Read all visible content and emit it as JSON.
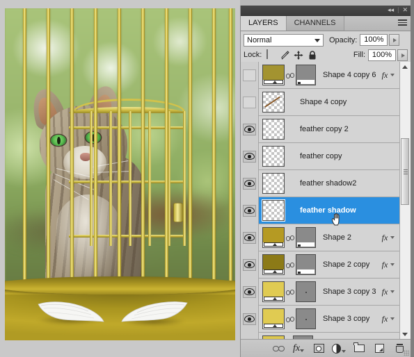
{
  "panel": {
    "titlebar": {
      "collapse_icon": "collapse-double-arrow-icon",
      "collapse_glyph": "◂◂",
      "close_glyph": "✕",
      "separator": "|"
    },
    "tabs": [
      {
        "label": "LAYERS",
        "active": true
      },
      {
        "label": "CHANNELS",
        "active": false
      }
    ],
    "menu_icon": "panel-menu-icon",
    "blend_mode": {
      "value": "Normal",
      "caret_icon": "chevron-down-icon"
    },
    "opacity": {
      "label": "Opacity:",
      "value": "100%",
      "stepper_icon": "play-triangle-icon"
    },
    "fill": {
      "label": "Fill:",
      "value": "100%",
      "stepper_icon": "play-triangle-icon"
    },
    "lock": {
      "label": "Lock:",
      "items": [
        {
          "name": "lock-transparent-pixels-icon",
          "glyph": "checker"
        },
        {
          "name": "lock-image-pixels-brush-icon",
          "glyph": "brush"
        },
        {
          "name": "lock-position-move-icon",
          "glyph": "move"
        },
        {
          "name": "lock-all-padlock-icon",
          "glyph": "lock"
        }
      ]
    }
  },
  "layers": [
    {
      "name": "Shape 4 copy 6",
      "visible": false,
      "selected": false,
      "thumb_type": "gold-gradient",
      "thumb_color": "#a39330",
      "has_link": true,
      "has_mask": true,
      "mask_type": "gray-bottom-white",
      "has_fx": true
    },
    {
      "name": "Shape 4 copy",
      "visible": false,
      "selected": false,
      "thumb_type": "transparent-diagonal",
      "thumb_color": "",
      "has_link": false,
      "has_mask": false,
      "mask_type": "",
      "has_fx": false
    },
    {
      "name": "feather copy 2",
      "visible": true,
      "selected": false,
      "thumb_type": "transparent",
      "thumb_color": "",
      "has_link": false,
      "has_mask": false,
      "mask_type": "",
      "has_fx": false
    },
    {
      "name": "feather copy",
      "visible": true,
      "selected": false,
      "thumb_type": "transparent",
      "thumb_color": "",
      "has_link": false,
      "has_mask": false,
      "mask_type": "",
      "has_fx": false
    },
    {
      "name": "feather shadow2",
      "visible": true,
      "selected": false,
      "thumb_type": "transparent",
      "thumb_color": "",
      "has_link": false,
      "has_mask": false,
      "mask_type": "",
      "has_fx": false
    },
    {
      "name": "feather shadow",
      "visible": true,
      "selected": true,
      "thumb_type": "transparent",
      "thumb_color": "",
      "has_link": false,
      "has_mask": false,
      "mask_type": "",
      "has_fx": false
    },
    {
      "name": "Shape 2",
      "visible": true,
      "selected": false,
      "thumb_type": "gold-gradient",
      "thumb_color": "#b59a23",
      "has_link": true,
      "has_mask": true,
      "mask_type": "gray-bottom-white",
      "has_fx": true
    },
    {
      "name": "Shape 2 copy",
      "visible": true,
      "selected": false,
      "thumb_type": "gold-gradient",
      "thumb_color": "#8c7a17",
      "has_link": true,
      "has_mask": true,
      "mask_type": "gray-bottom-white",
      "has_fx": true
    },
    {
      "name": "Shape 3 copy 3",
      "visible": true,
      "selected": false,
      "thumb_type": "gold-gradient",
      "thumb_color": "#e0cb52",
      "has_link": true,
      "has_mask": true,
      "mask_type": "gray-dot",
      "has_fx": true
    },
    {
      "name": "Shape 3 copy",
      "visible": true,
      "selected": false,
      "thumb_type": "gold-gradient",
      "thumb_color": "#e0cb52",
      "has_link": true,
      "has_mask": true,
      "mask_type": "gray-dot",
      "has_fx": true
    },
    {
      "name": "",
      "visible": true,
      "selected": false,
      "thumb_type": "gold-gradient",
      "thumb_color": "#ddc850",
      "has_link": false,
      "has_mask": true,
      "mask_type": "gray-bottom-white",
      "has_fx": false
    }
  ],
  "footer": {
    "buttons": [
      {
        "name": "link-layers-button",
        "icon": "chain-link-icon"
      },
      {
        "name": "add-layer-style-button",
        "icon": "fx-icon",
        "label": "fx"
      },
      {
        "name": "add-layer-mask-button",
        "icon": "layer-mask-icon"
      },
      {
        "name": "new-adjustment-layer-button",
        "icon": "adjustment-circle-icon"
      },
      {
        "name": "new-group-button",
        "icon": "folder-icon"
      },
      {
        "name": "new-layer-button",
        "icon": "new-layer-icon"
      },
      {
        "name": "delete-layer-button",
        "icon": "trash-icon"
      }
    ],
    "resize_grip_icon": "resize-grip-icon"
  },
  "scrollbar": {
    "up_arrow_icon": "scroll-up-arrow-icon",
    "down_arrow_icon": "scroll-down-arrow-icon",
    "thumb_name": "scroll-thumb"
  },
  "canvas": {
    "description": "tabby-cat-in-gold-birdcage-photo",
    "cursor_icon": "hand-pointer-cursor"
  },
  "colors": {
    "selection_blue": "#2a8fe0",
    "panel_gray": "#d4d4d4",
    "cage_gold": "#d9c84f",
    "cage_base_gold": "#b8a22a"
  }
}
